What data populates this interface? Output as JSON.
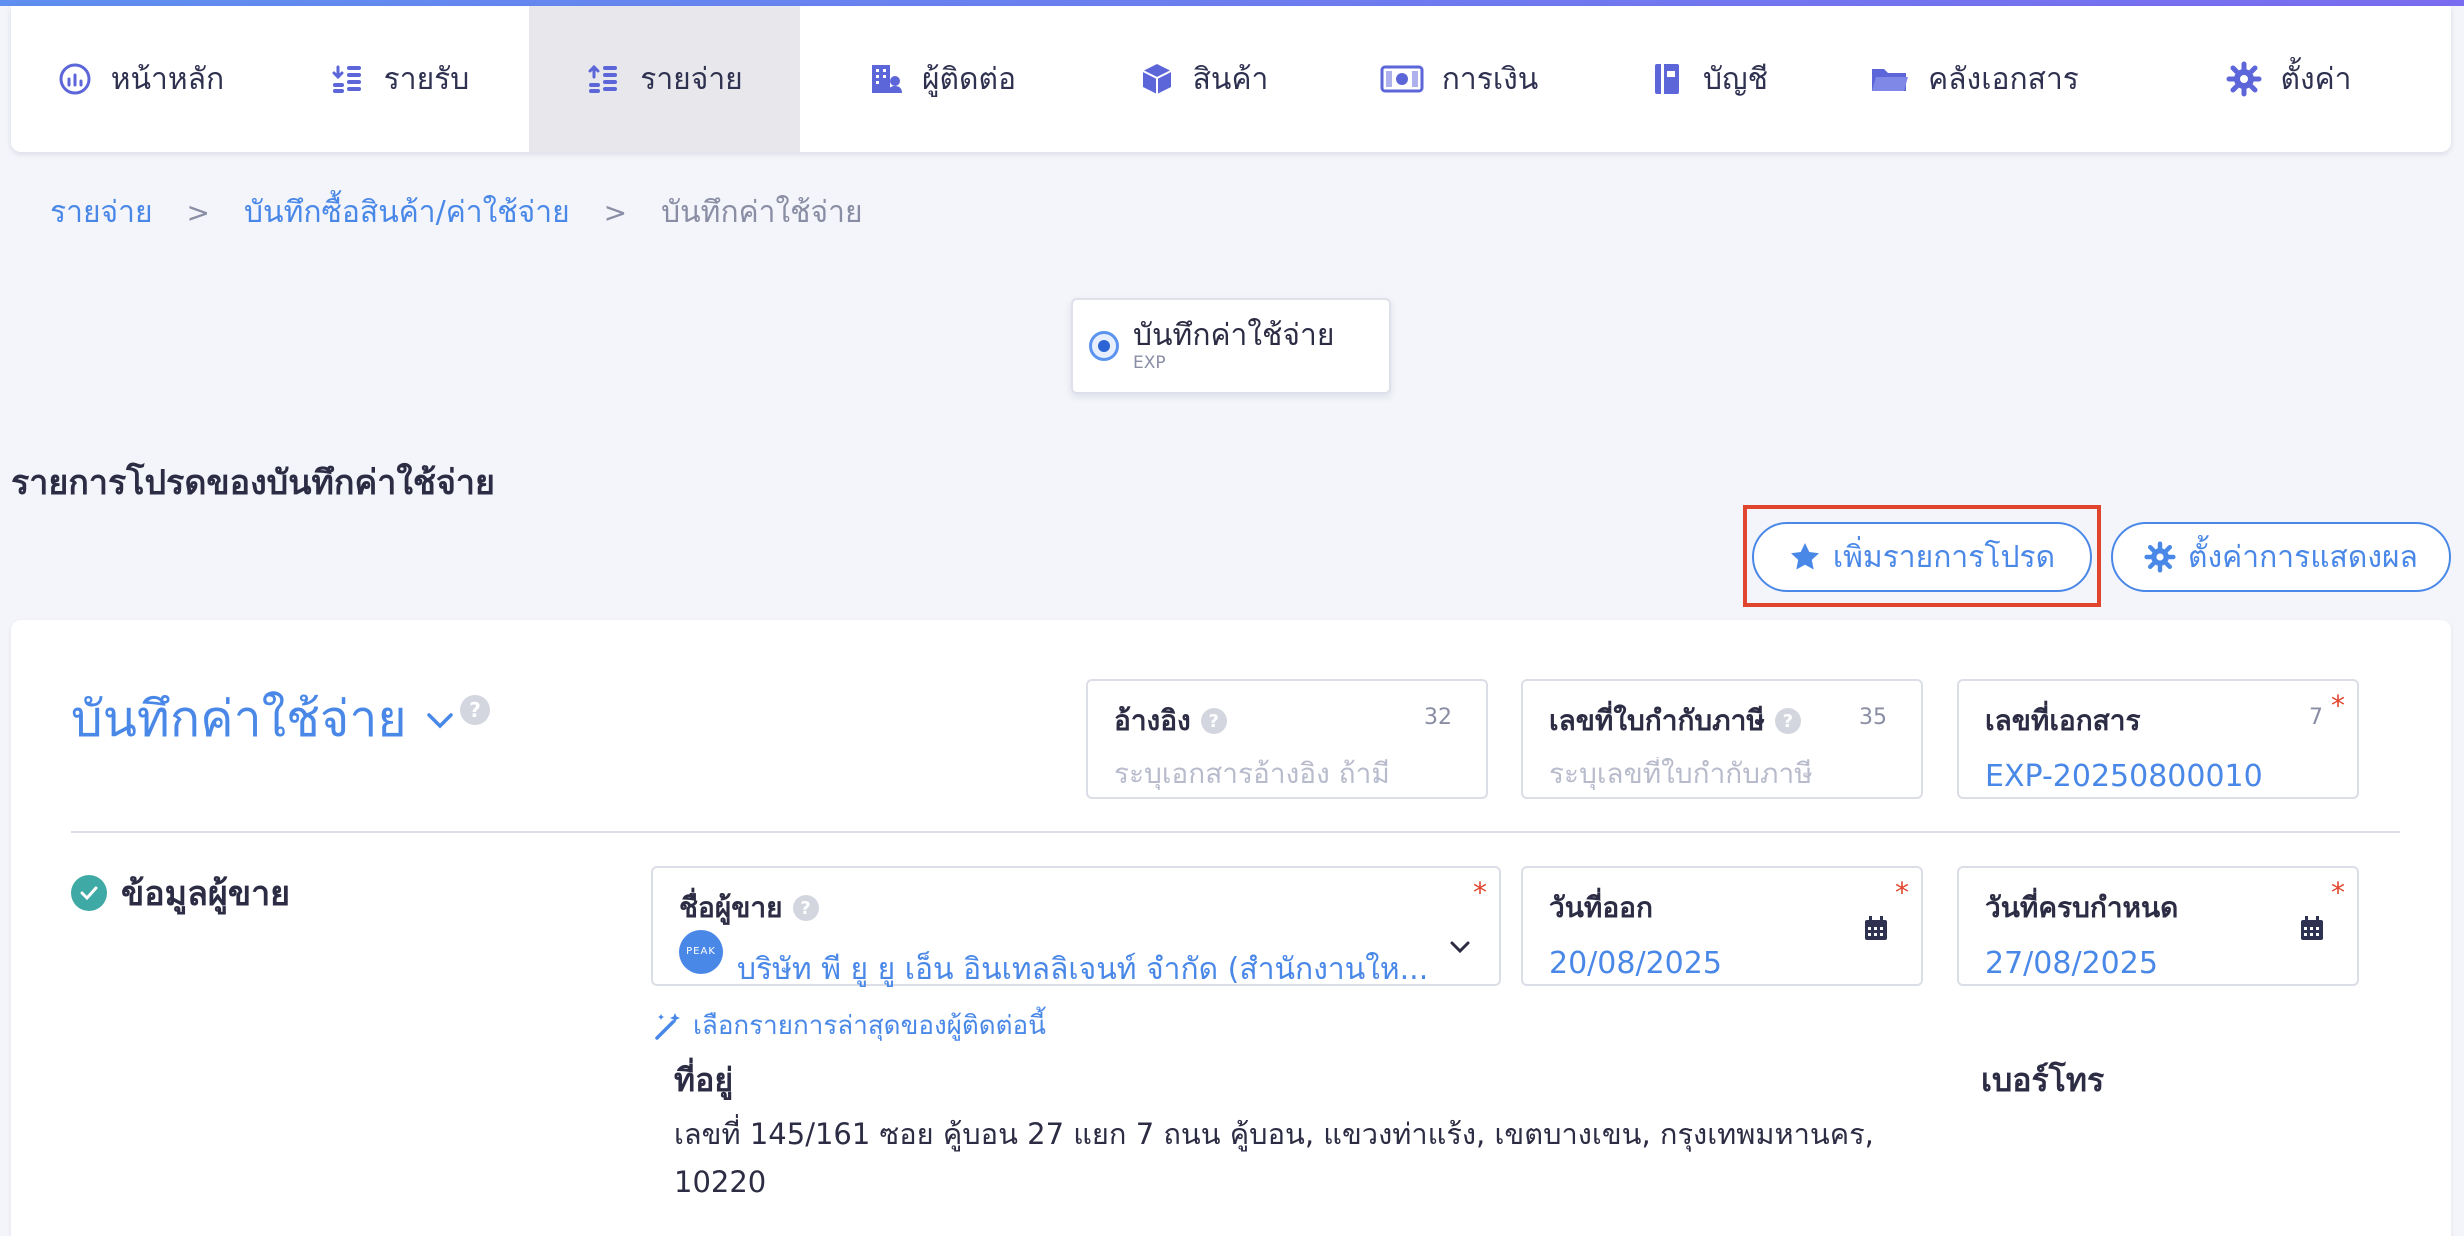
{
  "nav": {
    "items": [
      {
        "label": "หน้าหลัก",
        "icon": "dashboard-gauge-icon"
      },
      {
        "label": "รายรับ",
        "icon": "income-coins-icon"
      },
      {
        "label": "รายจ่าย",
        "icon": "expense-coins-icon"
      },
      {
        "label": "ผู้ติดต่อ",
        "icon": "contacts-building-icon"
      },
      {
        "label": "สินค้า",
        "icon": "product-box-icon"
      },
      {
        "label": "การเงิน",
        "icon": "money-bill-icon"
      },
      {
        "label": "บัญชี",
        "icon": "account-book-icon"
      },
      {
        "label": "คลังเอกสาร",
        "icon": "folder-icon"
      },
      {
        "label": "ตั้งค่า",
        "icon": "gear-icon"
      }
    ],
    "active": "รายจ่าย"
  },
  "breadcrumb": {
    "items": [
      "รายจ่าย",
      "บันทึกซื้อสินค้า/ค่าใช้จ่าย"
    ],
    "separator": ">",
    "current": "บันทึกค่าใช้จ่าย"
  },
  "doc_type": {
    "label": "บันทึกค่าใช้จ่าย",
    "code": "EXP"
  },
  "favorites": {
    "heading": "รายการโปรดของบันทึกค่าใช้จ่าย",
    "add_label": "เพิ่มรายการโปรด",
    "display_settings_label": "ตั้งค่าการแสดงผล"
  },
  "form": {
    "title": "บันทึกค่าใช้จ่าย",
    "reference": {
      "label": "อ้างอิง",
      "count": "32",
      "placeholder": "ระบุเอกสารอ้างอิง ถ้ามี"
    },
    "tax_invoice": {
      "label": "เลขที่ใบกำกับภาษี",
      "count": "35",
      "placeholder": "ระบุเลขที่ใบกำกับภาษี"
    },
    "doc_number": {
      "label": "เลขที่เอกสาร",
      "count": "7",
      "value": "EXP-20250800010"
    },
    "vendor_section": {
      "title": "ข้อมูลผู้ขาย",
      "vendor": {
        "label": "ชื่อผู้ขาย",
        "logo_text": "PEAK",
        "value": "บริษัท พี ยู ยู เอ็น อินเทลลิเจนท์ จำกัด (สำนักงานให..."
      },
      "issue_date": {
        "label": "วันที่ออก",
        "value": "20/08/2025"
      },
      "due_date": {
        "label": "วันที่ครบกำหนด",
        "value": "27/08/2025"
      },
      "recent_link": "เลือกรายการล่าสุดของผู้ติดต่อนี้",
      "address_label": "ที่อยู่",
      "address": "เลขที่ 145/161 ซอย คู้บอน 27 แยก 7 ถนน คู้บอน, แขวงท่าแร้ง, เขตบางเขน, กรุงเทพมหานคร, 10220",
      "phone_label": "เบอร์โทร",
      "required_mark": "*"
    }
  },
  "colors": {
    "accent": "#4a88e8",
    "required": "#e0462e",
    "check": "#3fa9a5",
    "highlight": "#e0462e"
  }
}
